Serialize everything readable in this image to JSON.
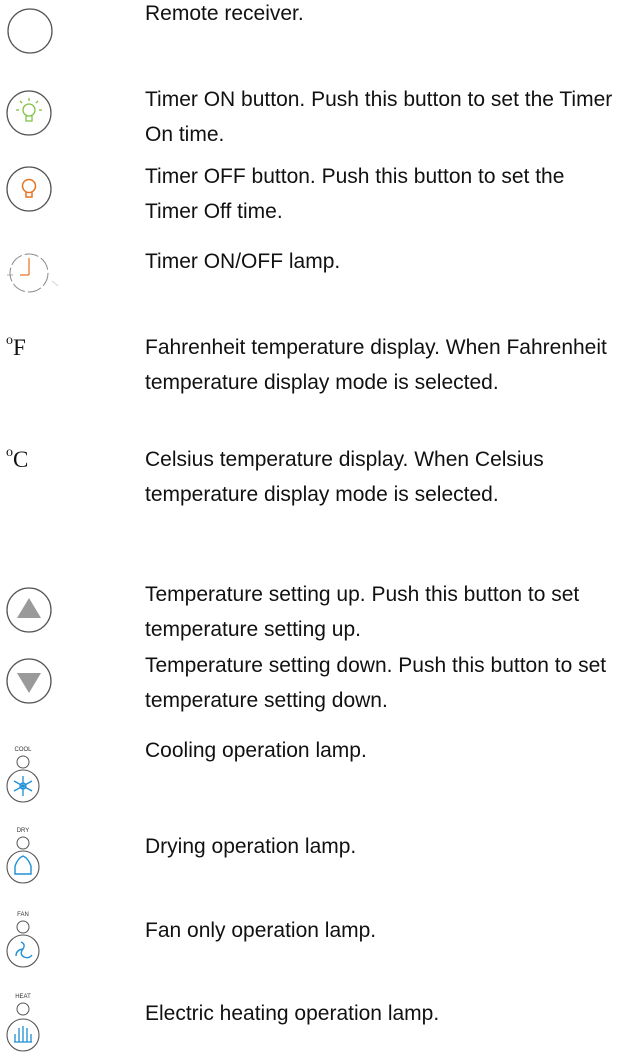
{
  "items": [
    {
      "icon": "remote-receiver-icon",
      "text": "Remote receiver."
    },
    {
      "icon": "timer-on-button-icon",
      "text": "Timer ON button. Push this button to set the Timer On time."
    },
    {
      "icon": "timer-off-button-icon",
      "text": "Timer OFF button. Push this button to set the Timer Off time."
    },
    {
      "icon": "timer-lamp-icon",
      "text": "Timer ON/OFF lamp."
    },
    {
      "symbol": "oF",
      "text": "Fahrenheit temperature display. When Fahrenheit temperature display mode is selected."
    },
    {
      "symbol": "oC",
      "text": "Celsius temperature display. When Celsius temperature display mode is selected."
    },
    {
      "icon": "temp-up-button-icon",
      "text": "Temperature setting up. Push this button to set temperature setting up."
    },
    {
      "icon": "temp-down-button-icon",
      "text": "Temperature setting down. Push this button to set temperature setting down."
    },
    {
      "icon": "cool-lamp-icon",
      "label": "COOL",
      "text": "Cooling operation lamp."
    },
    {
      "icon": "dry-lamp-icon",
      "label": "DRY",
      "text": "Drying operation lamp."
    },
    {
      "icon": "fan-lamp-icon",
      "label": "FAN",
      "text": "Fan only operation lamp."
    },
    {
      "icon": "heat-lamp-icon",
      "label": "HEAT",
      "text": "Electric heating operation lamp."
    }
  ],
  "colors": {
    "outline": "#555555",
    "timer_on": "#7dc242",
    "timer_off": "#e8731e",
    "arrow": "#9a9a9a",
    "mode_blue": "#1e8fd6"
  }
}
